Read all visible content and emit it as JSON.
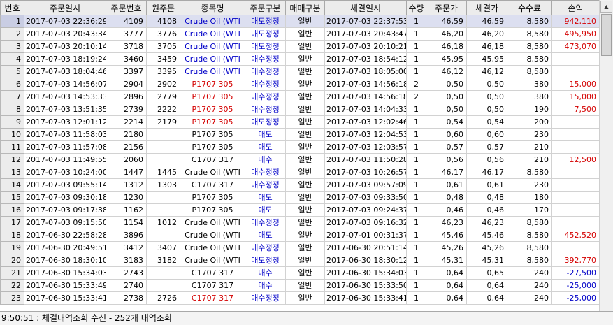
{
  "columns": [
    "번호",
    "주문일시",
    "주문번호",
    "원주문",
    "종목명",
    "주문구분",
    "매매구분",
    "체결일시",
    "수량",
    "주문가",
    "체결가",
    "수수료",
    "손익"
  ],
  "rows": [
    {
      "no": "1",
      "order_time": "2017-07-03 22:36:29",
      "order_no": "4109",
      "orig_no": "4108",
      "symbol": "Crude Oil (WTI",
      "order_type": "매도정정",
      "trade_type": "일반",
      "fill_time": "2017-07-03 22:37:53",
      "qty": "1",
      "order_price": "46,59",
      "fill_price": "46,59",
      "fee": "8,580",
      "pnl": "942,110"
    },
    {
      "no": "2",
      "order_time": "2017-07-03 20:43:34",
      "order_no": "3777",
      "orig_no": "3776",
      "symbol": "Crude Oil (WTI",
      "order_type": "매도정정",
      "trade_type": "일반",
      "fill_time": "2017-07-03 20:43:47",
      "qty": "1",
      "order_price": "46,20",
      "fill_price": "46,20",
      "fee": "8,580",
      "pnl": "495,950"
    },
    {
      "no": "3",
      "order_time": "2017-07-03 20:10:14",
      "order_no": "3718",
      "orig_no": "3705",
      "symbol": "Crude Oil (WTI",
      "order_type": "매도정정",
      "trade_type": "일반",
      "fill_time": "2017-07-03 20:10:21",
      "qty": "1",
      "order_price": "46,18",
      "fill_price": "46,18",
      "fee": "8,580",
      "pnl": "473,070"
    },
    {
      "no": "4",
      "order_time": "2017-07-03 18:19:24",
      "order_no": "3460",
      "orig_no": "3459",
      "symbol": "Crude Oil (WTI",
      "order_type": "매수정정",
      "trade_type": "일반",
      "fill_time": "2017-07-03 18:54:12",
      "qty": "1",
      "order_price": "45,95",
      "fill_price": "45,95",
      "fee": "8,580",
      "pnl": ""
    },
    {
      "no": "5",
      "order_time": "2017-07-03 18:04:46",
      "order_no": "3397",
      "orig_no": "3395",
      "symbol": "Crude Oil (WTI",
      "order_type": "매수정정",
      "trade_type": "일반",
      "fill_time": "2017-07-03 18:05:00",
      "qty": "1",
      "order_price": "46,12",
      "fill_price": "46,12",
      "fee": "8,580",
      "pnl": ""
    },
    {
      "no": "6",
      "order_time": "2017-07-03 14:56:07",
      "order_no": "2904",
      "orig_no": "2902",
      "symbol": "P1707 305",
      "order_type": "매수정정",
      "trade_type": "일반",
      "fill_time": "2017-07-03 14:56:18",
      "qty": "2",
      "order_price": "0,50",
      "fill_price": "0,50",
      "fee": "380",
      "pnl": "15,000"
    },
    {
      "no": "7",
      "order_time": "2017-07-03 14:53:33",
      "order_no": "2896",
      "orig_no": "2779",
      "symbol": "P1707 305",
      "order_type": "매수정정",
      "trade_type": "일반",
      "fill_time": "2017-07-03 14:56:18",
      "qty": "2",
      "order_price": "0,50",
      "fill_price": "0,50",
      "fee": "380",
      "pnl": "15,000"
    },
    {
      "no": "8",
      "order_time": "2017-07-03 13:51:35",
      "order_no": "2739",
      "orig_no": "2222",
      "symbol": "P1707 305",
      "order_type": "매수정정",
      "trade_type": "일반",
      "fill_time": "2017-07-03 14:04:33",
      "qty": "1",
      "order_price": "0,50",
      "fill_price": "0,50",
      "fee": "190",
      "pnl": "7,500"
    },
    {
      "no": "9",
      "order_time": "2017-07-03 12:01:12",
      "order_no": "2214",
      "orig_no": "2179",
      "symbol": "P1707 305",
      "order_type": "매도정정",
      "trade_type": "일반",
      "fill_time": "2017-07-03 12:02:46",
      "qty": "1",
      "order_price": "0,54",
      "fill_price": "0,54",
      "fee": "200",
      "pnl": ""
    },
    {
      "no": "10",
      "order_time": "2017-07-03 11:58:03",
      "order_no": "2180",
      "orig_no": "",
      "symbol": "P1707 305",
      "order_type": "매도",
      "trade_type": "일반",
      "fill_time": "2017-07-03 12:04:53",
      "qty": "1",
      "order_price": "0,60",
      "fill_price": "0,60",
      "fee": "230",
      "pnl": ""
    },
    {
      "no": "11",
      "order_time": "2017-07-03 11:57:08",
      "order_no": "2156",
      "orig_no": "",
      "symbol": "P1707 305",
      "order_type": "매도",
      "trade_type": "일반",
      "fill_time": "2017-07-03 12:03:57",
      "qty": "1",
      "order_price": "0,57",
      "fill_price": "0,57",
      "fee": "210",
      "pnl": ""
    },
    {
      "no": "12",
      "order_time": "2017-07-03 11:49:55",
      "order_no": "2060",
      "orig_no": "",
      "symbol": "C1707 317",
      "order_type": "매수",
      "trade_type": "일반",
      "fill_time": "2017-07-03 11:50:28",
      "qty": "1",
      "order_price": "0,56",
      "fill_price": "0,56",
      "fee": "210",
      "pnl": "12,500"
    },
    {
      "no": "13",
      "order_time": "2017-07-03 10:24:00",
      "order_no": "1447",
      "orig_no": "1445",
      "symbol": "Crude Oil (WTI",
      "order_type": "매수정정",
      "trade_type": "일반",
      "fill_time": "2017-07-03 10:26:57",
      "qty": "1",
      "order_price": "46,17",
      "fill_price": "46,17",
      "fee": "8,580",
      "pnl": ""
    },
    {
      "no": "14",
      "order_time": "2017-07-03 09:55:14",
      "order_no": "1312",
      "orig_no": "1303",
      "symbol": "C1707 317",
      "order_type": "매수정정",
      "trade_type": "일반",
      "fill_time": "2017-07-03 09:57:09",
      "qty": "1",
      "order_price": "0,61",
      "fill_price": "0,61",
      "fee": "230",
      "pnl": ""
    },
    {
      "no": "15",
      "order_time": "2017-07-03 09:30:18",
      "order_no": "1230",
      "orig_no": "",
      "symbol": "P1707 305",
      "order_type": "매도",
      "trade_type": "일반",
      "fill_time": "2017-07-03 09:33:50",
      "qty": "1",
      "order_price": "0,48",
      "fill_price": "0,48",
      "fee": "180",
      "pnl": ""
    },
    {
      "no": "16",
      "order_time": "2017-07-03 09:17:38",
      "order_no": "1162",
      "orig_no": "",
      "symbol": "P1707 305",
      "order_type": "매도",
      "trade_type": "일반",
      "fill_time": "2017-07-03 09:24:37",
      "qty": "1",
      "order_price": "0,46",
      "fill_price": "0,46",
      "fee": "170",
      "pnl": ""
    },
    {
      "no": "17",
      "order_time": "2017-07-03 09:15:50",
      "order_no": "1154",
      "orig_no": "1012",
      "symbol": "Crude Oil (WTI",
      "order_type": "매수정정",
      "trade_type": "일반",
      "fill_time": "2017-07-03 09:16:32",
      "qty": "1",
      "order_price": "46,23",
      "fill_price": "46,23",
      "fee": "8,580",
      "pnl": ""
    },
    {
      "no": "18",
      "order_time": "2017-06-30 22:58:28",
      "order_no": "3896",
      "orig_no": "",
      "symbol": "Crude Oil (WTI",
      "order_type": "매도",
      "trade_type": "일반",
      "fill_time": "2017-07-01 00:31:37",
      "qty": "1",
      "order_price": "45,46",
      "fill_price": "45,46",
      "fee": "8,580",
      "pnl": "452,520"
    },
    {
      "no": "19",
      "order_time": "2017-06-30 20:49:51",
      "order_no": "3412",
      "orig_no": "3407",
      "symbol": "Crude Oil (WTI",
      "order_type": "매수정정",
      "trade_type": "일반",
      "fill_time": "2017-06-30 20:51:14",
      "qty": "1",
      "order_price": "45,26",
      "fill_price": "45,26",
      "fee": "8,580",
      "pnl": ""
    },
    {
      "no": "20",
      "order_time": "2017-06-30 18:30:10",
      "order_no": "3183",
      "orig_no": "3182",
      "symbol": "Crude Oil (WTI",
      "order_type": "매도정정",
      "trade_type": "일반",
      "fill_time": "2017-06-30 18:30:12",
      "qty": "1",
      "order_price": "45,31",
      "fill_price": "45,31",
      "fee": "8,580",
      "pnl": "392,770"
    },
    {
      "no": "21",
      "order_time": "2017-06-30 15:34:03",
      "order_no": "2743",
      "orig_no": "",
      "symbol": "C1707 317",
      "order_type": "매수",
      "trade_type": "일반",
      "fill_time": "2017-06-30 15:34:03",
      "qty": "1",
      "order_price": "0,64",
      "fill_price": "0,65",
      "fee": "240",
      "pnl": "-27,500"
    },
    {
      "no": "22",
      "order_time": "2017-06-30 15:33:49",
      "order_no": "2740",
      "orig_no": "",
      "symbol": "C1707 317",
      "order_type": "매수",
      "trade_type": "일반",
      "fill_time": "2017-06-30 15:33:50",
      "qty": "1",
      "order_price": "0,64",
      "fill_price": "0,64",
      "fee": "240",
      "pnl": "-25,000"
    },
    {
      "no": "23",
      "order_time": "2017-06-30 15:33:41",
      "order_no": "2738",
      "orig_no": "2726",
      "symbol": "C1707 317",
      "order_type": "매수정정",
      "trade_type": "일반",
      "fill_time": "2017-06-30 15:33:41",
      "qty": "1",
      "order_price": "0,64",
      "fill_price": "0,64",
      "fee": "240",
      "pnl": "-25,000"
    }
  ],
  "status_bar": {
    "text": "9:50:51 : 체결내역조회 수신 - 252개 내역조회"
  },
  "colors": {
    "red": "#d40000",
    "blue": "#0000c8",
    "selected_row": "#dcdff0",
    "header_bg": "#ececec"
  },
  "icons": {
    "scroll_up": "triangle-up",
    "scroll_down": "triangle-down"
  }
}
